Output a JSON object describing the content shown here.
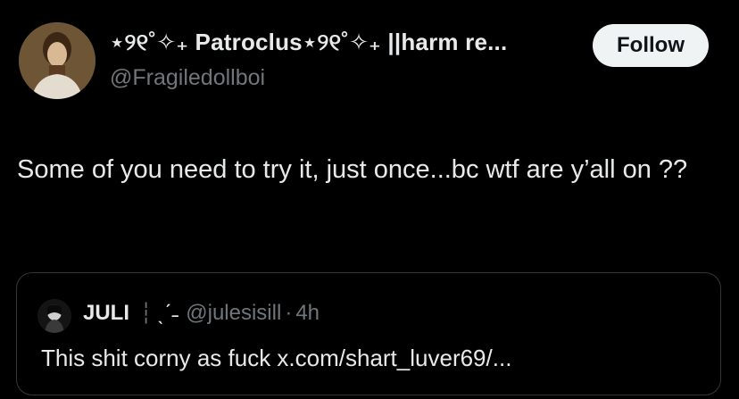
{
  "author": {
    "display_name": "⋆୨୧˚✧₊ Patroclus⋆୨୧˚✧₊ ||harm re...",
    "handle": "@Fragiledollboi",
    "avatar": "avatar-photo"
  },
  "follow_button": {
    "label": "Follow"
  },
  "tweet": {
    "text": "Some of you need to try it, just once...bc wtf are y’all on ??"
  },
  "quoted_tweet": {
    "name": "JULI",
    "separator": "┆",
    "decoration": "ˎˊ˗",
    "handle": "@julesisill",
    "dot": "·",
    "time": "4h",
    "text": "This shit corny as fuck x.com/shart_luver69/...",
    "avatar": "avatar-photo"
  },
  "colors": {
    "background": "#000000",
    "text_primary": "#e7e9ea",
    "text_secondary": "#71767b",
    "border": "#333639",
    "follow_bg": "#eff3f4"
  }
}
